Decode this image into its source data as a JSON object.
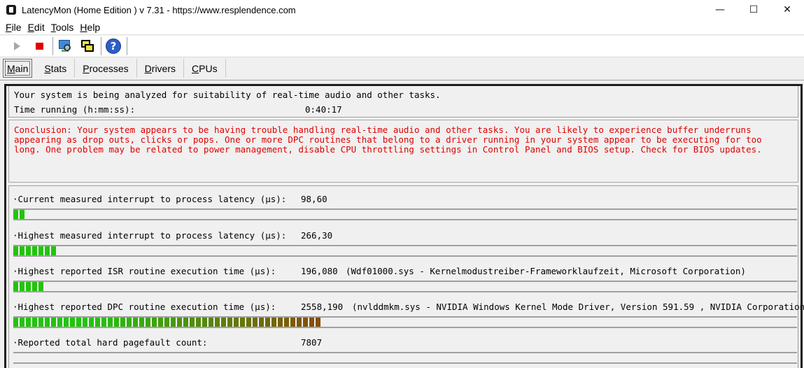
{
  "window": {
    "title": "LatencyMon  (Home Edition )  v 7.31 - https://www.resplendence.com",
    "minimize": "—",
    "maximize": "☐",
    "close": "✕"
  },
  "menu": {
    "items": [
      {
        "key": "F",
        "rest": "ile"
      },
      {
        "key": "E",
        "rest": "dit"
      },
      {
        "key": "T",
        "rest": "ools"
      },
      {
        "key": "H",
        "rest": "elp"
      }
    ]
  },
  "toolbar": {
    "icons": [
      "play-icon",
      "stop-icon",
      "search-icon",
      "windows-icon",
      "help-icon"
    ],
    "help_glyph": "?"
  },
  "tabs": [
    {
      "key": "M",
      "rest": "ain",
      "active": true
    },
    {
      "key": "S",
      "rest": "tats",
      "active": false
    },
    {
      "key": "P",
      "rest": "rocesses",
      "active": false
    },
    {
      "key": "D",
      "rest": "rivers",
      "active": false
    },
    {
      "key": "C",
      "rest": "PUs",
      "active": false
    }
  ],
  "status": {
    "analyzing": "Your system is being analyzed for suitability of real-time audio and other tasks.",
    "time_label": "Time running (h:mm:ss):",
    "time_value": "0:40:17"
  },
  "conclusion": "Conclusion: Your system appears to be having trouble handling real-time audio and other tasks. You are likely to experience buffer underruns appearing as drop outs, clicks or pops. One or more DPC routines that belong to a driver running in your system appear to be executing for too long. One problem may be related to power management, disable CPU throttling settings in Control Panel and BIOS setup. Check for BIOS updates.",
  "metrics": [
    {
      "label": "·Current measured interrupt to process latency (µs):",
      "value": "98,60",
      "note": "",
      "segments": 2
    },
    {
      "label": "·Highest measured interrupt to process latency (µs):",
      "value": "266,30",
      "note": "",
      "segments": 7
    },
    {
      "label": "·Highest reported ISR routine execution time (µs):",
      "value": "196,080",
      "note": "(Wdf01000.sys - Kernelmodustreiber-Frameworklaufzeit, Microsoft Corporation)",
      "segments": 5
    },
    {
      "label": "·Highest reported DPC routine execution time (µs):",
      "value": "2558,190",
      "note": "(nvlddmkm.sys - NVIDIA Windows Kernel Mode Driver, Version 591.59 , NVIDIA Corporation)",
      "segments": 49
    },
    {
      "label": "·Reported total hard pagefault count:",
      "value": "7807",
      "note": "",
      "segments": 0
    }
  ],
  "colors": {
    "conclusion_text": "#e00000",
    "bar_green": "#22c40e",
    "bar_brown": "#8a4a06"
  }
}
